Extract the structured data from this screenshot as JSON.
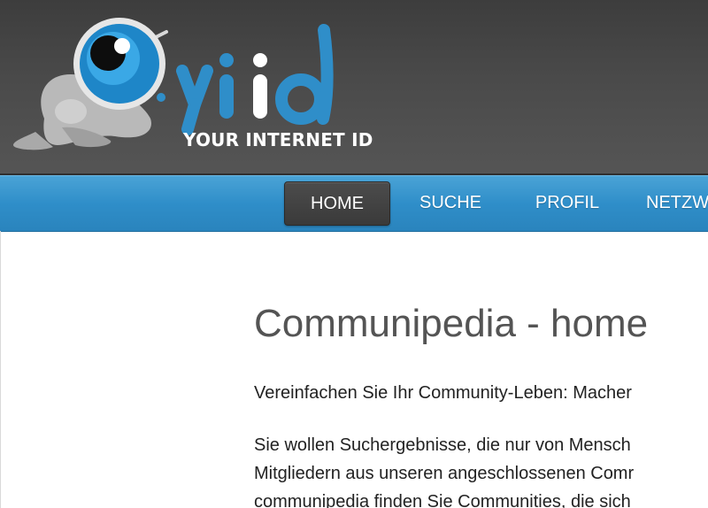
{
  "header": {
    "logo_alt": "yiid",
    "tagline": "YOUR INTERNET ID",
    "colors": {
      "brand_blue": "#2f8ec9",
      "header_bg": "#4a4a4a"
    }
  },
  "nav": {
    "items": [
      {
        "label": "HOME",
        "active": true
      },
      {
        "label": "SUCHE",
        "active": false
      },
      {
        "label": "PROFIL",
        "active": false
      },
      {
        "label": "NETZW",
        "active": false
      }
    ]
  },
  "main": {
    "title": "Communipedia - home",
    "intro": "Vereinfachen Sie Ihr Community-Leben: Macher",
    "paragraph_lines": [
      "Sie wollen Suchergebnisse, die nur von Mensch",
      "Mitgliedern aus unseren angeschlossenen Comr",
      "communipedia finden Sie Communities, die sich"
    ]
  }
}
